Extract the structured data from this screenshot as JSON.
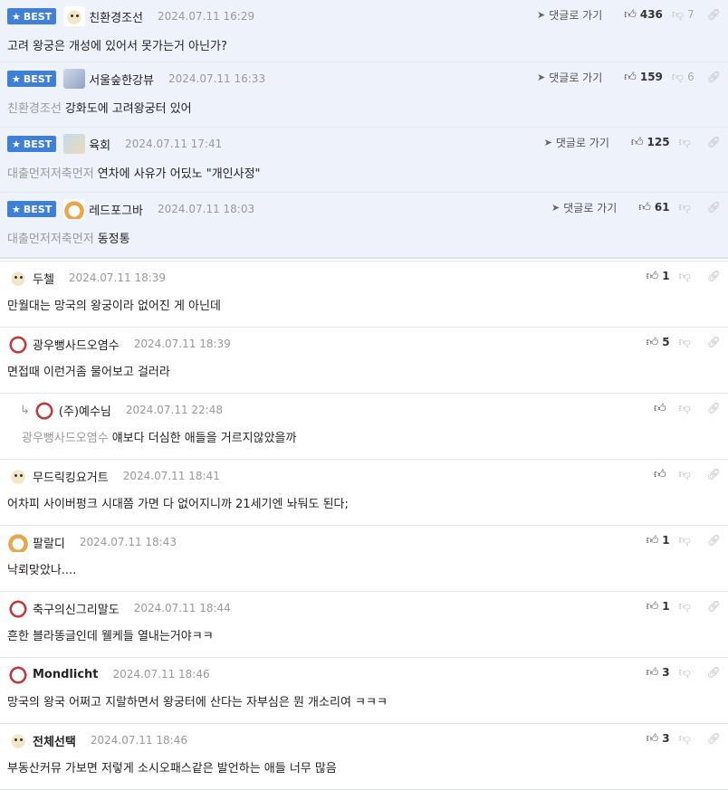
{
  "goto_label": "댓글로 가기",
  "best_label": "BEST",
  "comments": [
    {
      "kind": "best",
      "nick": "친환경조선",
      "date": "2024.07.11 16:29",
      "mention": "",
      "text": "고려 왕궁은 개성에 있어서 못가는거 아닌가?",
      "likes": "436",
      "dislikes": "7",
      "avatar": "dog"
    },
    {
      "kind": "best",
      "nick": "서울숲한강뷰",
      "date": "2024.07.11 16:33",
      "mention": "친환경조선",
      "text": "강화도에 고려왕궁터 있어",
      "likes": "159",
      "dislikes": "6",
      "avatar": "cat"
    },
    {
      "kind": "best",
      "nick": "육회",
      "date": "2024.07.11 17:41",
      "mention": "대출먼저저축먼저",
      "text": "연차에 사유가 어딨노 \"개인사정\"",
      "likes": "125",
      "dislikes": "",
      "avatar": "bear"
    },
    {
      "kind": "best",
      "nick": "레드포그바",
      "date": "2024.07.11 18:03",
      "mention": "대출먼저저축먼저",
      "text": "동정통",
      "likes": "61",
      "dislikes": "",
      "avatar": "fox"
    },
    {
      "kind": "normal",
      "nick": "두첼",
      "date": "2024.07.11 18:39",
      "mention": "",
      "text": "만월대는 망국의 왕궁이라 없어진 게 아닌데",
      "likes": "1",
      "dislikes": "",
      "avatar": "dog"
    },
    {
      "kind": "normal",
      "nick": "광우뻥사드오염수",
      "date": "2024.07.11 18:39",
      "mention": "",
      "text": "면접때 이런거좀 물어보고 걸러라",
      "likes": "5",
      "dislikes": "",
      "avatar": "red"
    },
    {
      "kind": "reply",
      "nick": "(주)예수님",
      "date": "2024.07.11 22:48",
      "mention": "광우뻥사드오염수",
      "text": "얘보다 더심한 애들을 거르지않았을까",
      "likes": "",
      "dislikes": "",
      "avatar": "red"
    },
    {
      "kind": "normal",
      "nick": "무드릭킹요거트",
      "date": "2024.07.11 18:41",
      "mention": "",
      "text": "어차피 사이버펑크 시대쯤 가면 다 없어지니까 21세기엔 놔둬도 된다;",
      "likes": "",
      "dislikes": "",
      "avatar": "dog"
    },
    {
      "kind": "normal",
      "nick": "팔랄디",
      "date": "2024.07.11 18:43",
      "mention": "",
      "text": "낙뢰맞았나....",
      "likes": "1",
      "dislikes": "",
      "avatar": "fox"
    },
    {
      "kind": "normal",
      "nick": "축구의신그리말도",
      "date": "2024.07.11 18:44",
      "mention": "",
      "text": "흔한 블라똥글인데 웰케들 열내는거야ㅋㅋ",
      "likes": "1",
      "dislikes": "",
      "avatar": "red"
    },
    {
      "kind": "normal",
      "nick": "Mondlicht",
      "date": "2024.07.11 18:46",
      "mention": "",
      "text": "망국의 왕국 어쩌고 지랄하면서 왕궁터에 산다는 자부심은 뭔 개소리여 ㅋㅋㅋ",
      "likes": "3",
      "dislikes": "",
      "avatar": "red",
      "bold": true
    },
    {
      "kind": "normal",
      "nick": "전체선택",
      "date": "2024.07.11 18:46",
      "mention": "",
      "text": "부동산커뮤 가보면 저렇게 소시오패스같은 발언하는 애들 너무 많음",
      "likes": "3",
      "dislikes": "",
      "avatar": "dog",
      "bold": true
    }
  ]
}
